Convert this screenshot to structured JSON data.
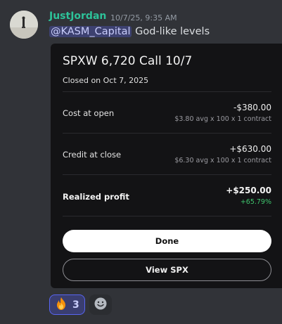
{
  "message": {
    "username": "JustJordan",
    "timestamp": "10/7/25, 9:35 AM",
    "mention": "@KASM_Capital",
    "text": " God-like levels"
  },
  "card": {
    "title": "SPXW 6,720 Call 10/7",
    "subtitle": "Closed on Oct 7, 2025",
    "rows": [
      {
        "label": "Cost at open",
        "amount": "-$380.00",
        "detail": "$3.80 avg x 100 x 1 contract"
      },
      {
        "label": "Credit at close",
        "amount": "+$630.00",
        "detail": "$6.30 avg x 100 x 1 contract"
      },
      {
        "label": "Realized profit",
        "amount": "+$250.00",
        "detail": "+65.79%"
      }
    ],
    "done_label": "Done",
    "view_label": "View SPX"
  },
  "reactions": [
    {
      "icon": "fire-icon",
      "count": "3"
    }
  ],
  "colors": {
    "username": "#2dc299",
    "mention_bg": "#5865f2",
    "profit_green": "#3ec46d"
  }
}
